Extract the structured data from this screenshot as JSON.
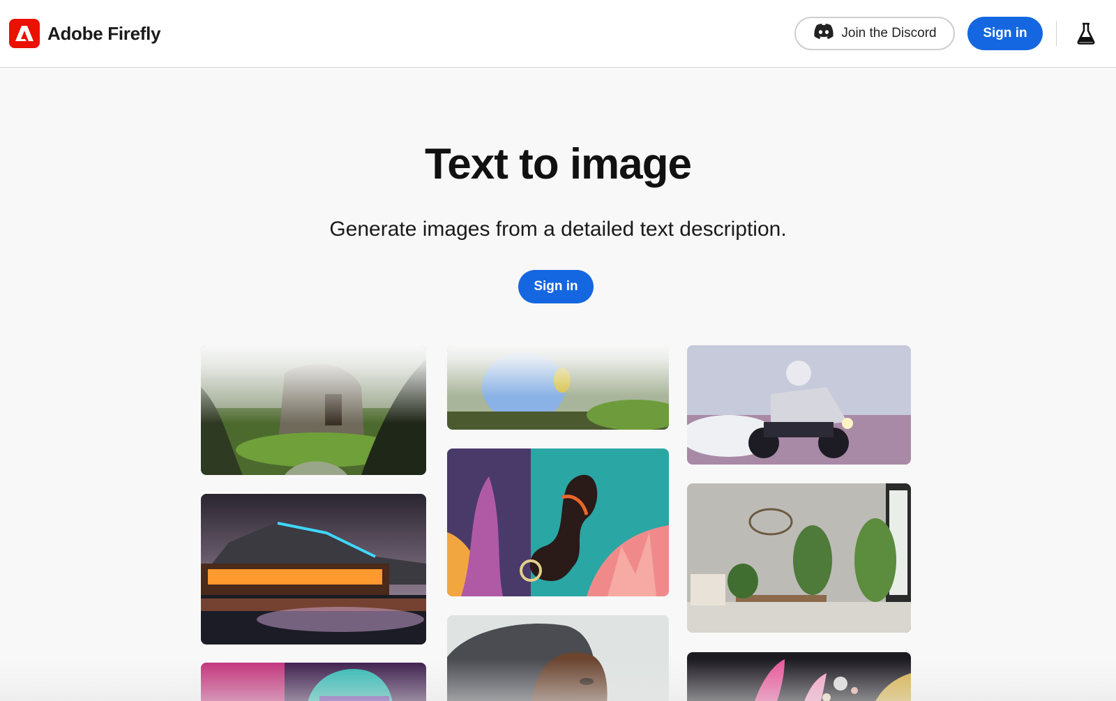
{
  "header": {
    "brand": "Adobe Firefly",
    "discord_label": "Join the Discord",
    "signin_label": "Sign in",
    "logo_icon": "adobe-logo-icon",
    "discord_icon": "discord-icon",
    "labs_icon": "flask-icon",
    "accent_color": "#1467e0",
    "logo_color": "#eb1000"
  },
  "hero": {
    "title": "Text to image",
    "subtitle": "Generate images from a detailed text description.",
    "signin_label": "Sign in"
  },
  "gallery": {
    "tiles": [
      "forest-treehouse-image",
      "fluffy-creature-image",
      "astronaut-motorcycle-image",
      "neon-lake-house-image",
      "seahorse-coral-image",
      "plant-living-room-image",
      "beanie-portrait-image",
      "woman-profile-image",
      "cosmic-powder-image"
    ]
  }
}
